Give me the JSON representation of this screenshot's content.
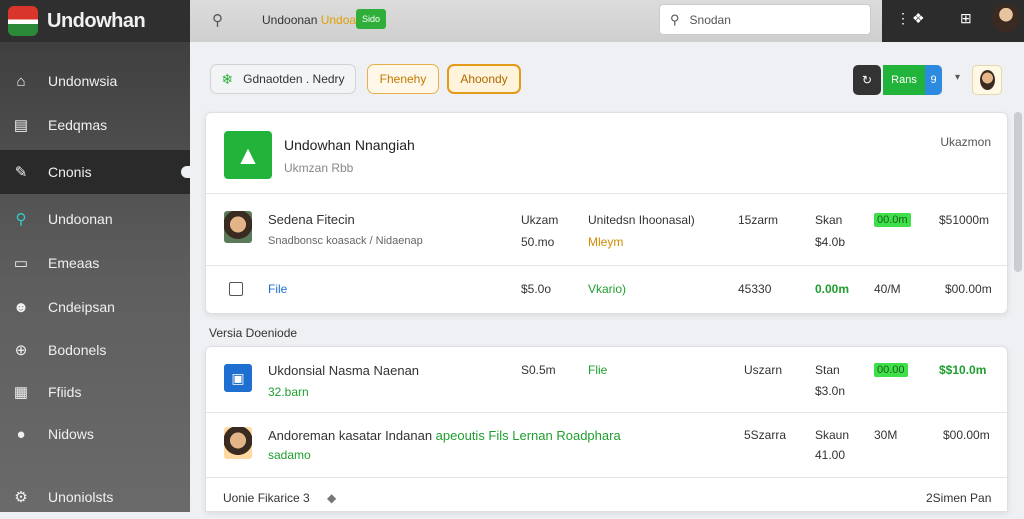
{
  "app": {
    "name": "Undowhan"
  },
  "sidebar": {
    "items": [
      {
        "label": "Undonwsia",
        "icon": "home-icon",
        "glyph": "⌂"
      },
      {
        "label": "Eedqmas",
        "icon": "document-icon",
        "glyph": "▤"
      },
      {
        "label": "Cnonis",
        "icon": "pen-icon",
        "glyph": "✎"
      },
      {
        "label": "Undoonan",
        "icon": "search-icon",
        "glyph": "⚲"
      },
      {
        "label": "Emeaas",
        "icon": "card-icon",
        "glyph": "▭"
      },
      {
        "label": "Cndeipsan",
        "icon": "people-icon",
        "glyph": "☻"
      },
      {
        "label": "Bodonels",
        "icon": "plus-circle-icon",
        "glyph": "⊕"
      },
      {
        "label": "Ffiids",
        "icon": "folder-icon",
        "glyph": "▦"
      },
      {
        "label": "Nidows",
        "icon": "chat-icon",
        "glyph": "●"
      },
      {
        "label": "Unoniolsts",
        "icon": "settings-icon",
        "glyph": "⚙"
      }
    ]
  },
  "topbar": {
    "title_pre": "Undoonan ",
    "title_highlight": "Undoan",
    "chip": "Sido",
    "search_placeholder": "Snodan"
  },
  "toolbar": {
    "filter_label": "Gdnaotden . Nedry",
    "tab1": "Fhenehy",
    "tab2": "Ahoondy",
    "action_green": "Rans",
    "action_blue": "9"
  },
  "card1": {
    "title": "Undowhan Nnangiah",
    "subtitle": "Ukmzan Rbb",
    "right": "Ukazmon",
    "row1": {
      "name": "Sedena Fitecin",
      "desc": "Snadbonsc koasack / Nidaenap",
      "c1a": "Ukzam",
      "c1b": "50.mo",
      "c2a": "Unitedsn Ihoonasal)",
      "c2b": "Mleym",
      "c3": "15zarm",
      "c4a": "Skan",
      "c4b": "$4.0b",
      "badge": "00.0m",
      "amount": "$51000m"
    },
    "row2": {
      "name": "File",
      "c1": "$5.0o",
      "c2": "Vkario)",
      "c3": "45330",
      "c4": "0.00m",
      "c5": "40/M",
      "amount": "$00.00m"
    }
  },
  "section": {
    "label": "Versia Doeniode"
  },
  "card2": {
    "row1": {
      "name": "Ukdonsial Nasma Naenan",
      "sub": "32.barn",
      "c1": "S0.5m",
      "c2": "Flie",
      "c3": "Uszarn",
      "c4a": "Stan",
      "c4b": "$3.0n",
      "badge": "00.00",
      "amount": "$$10.0m"
    },
    "row2": {
      "name_pre": "Andoreman kasatar Indanan ",
      "name_hl": "apeoutis Fils Lernan Roadphara",
      "sub": "sadamo",
      "c3": "5Szarra",
      "c4a": "Skaun",
      "c4b": "41.00",
      "c5": "30M",
      "amount": "$00.00m"
    },
    "footer": {
      "left": "Uonie Fikarice 3",
      "right": "2Simen Pan"
    }
  }
}
